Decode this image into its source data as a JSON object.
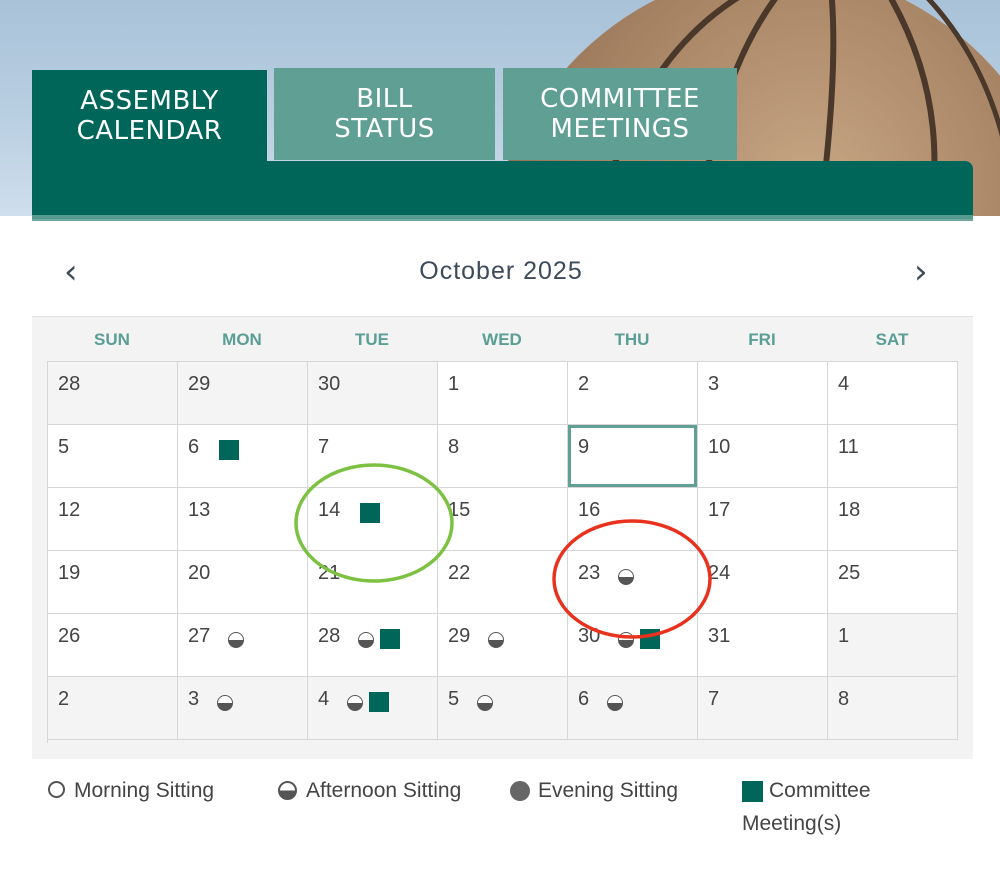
{
  "tabs": [
    {
      "label": "ASSEMBLY\nCALENDAR"
    },
    {
      "label": "BILL\nSTATUS"
    },
    {
      "label": "COMMITTEE\nMEETINGS"
    }
  ],
  "calendar": {
    "month_title": "October 2025",
    "prev_label": "‹",
    "next_label": "›",
    "days_of_week": [
      "SUN",
      "MON",
      "TUE",
      "WED",
      "THU",
      "FRI",
      "SAT"
    ],
    "weeks": [
      [
        {
          "day": "28",
          "other": true
        },
        {
          "day": "29",
          "other": true
        },
        {
          "day": "30",
          "other": true
        },
        {
          "day": "1"
        },
        {
          "day": "2"
        },
        {
          "day": "3"
        },
        {
          "day": "4"
        }
      ],
      [
        {
          "day": "5"
        },
        {
          "day": "6",
          "committee": true
        },
        {
          "day": "7"
        },
        {
          "day": "8"
        },
        {
          "day": "9",
          "today": true
        },
        {
          "day": "10"
        },
        {
          "day": "11"
        }
      ],
      [
        {
          "day": "12"
        },
        {
          "day": "13"
        },
        {
          "day": "14",
          "committee": true
        },
        {
          "day": "15"
        },
        {
          "day": "16"
        },
        {
          "day": "17"
        },
        {
          "day": "18"
        }
      ],
      [
        {
          "day": "19"
        },
        {
          "day": "20"
        },
        {
          "day": "21"
        },
        {
          "day": "22"
        },
        {
          "day": "23",
          "afternoon": true
        },
        {
          "day": "24"
        },
        {
          "day": "25"
        }
      ],
      [
        {
          "day": "26"
        },
        {
          "day": "27",
          "afternoon": true
        },
        {
          "day": "28",
          "afternoon": true,
          "committee": true
        },
        {
          "day": "29",
          "afternoon": true
        },
        {
          "day": "30",
          "afternoon": true,
          "committee": true
        },
        {
          "day": "31"
        },
        {
          "day": "1",
          "other": true
        }
      ],
      [
        {
          "day": "2",
          "other": true
        },
        {
          "day": "3",
          "afternoon": true,
          "other": true
        },
        {
          "day": "4",
          "afternoon": true,
          "committee": true,
          "other": true
        },
        {
          "day": "5",
          "afternoon": true,
          "other": true
        },
        {
          "day": "6",
          "afternoon": true,
          "other": true
        },
        {
          "day": "7",
          "other": true
        },
        {
          "day": "8",
          "other": true
        }
      ]
    ]
  },
  "legend": {
    "morning": "Morning Sitting",
    "afternoon": "Afternoon Sitting",
    "evening": "Evening Sitting",
    "committee_line1": "Committee",
    "committee_line2": "Meeting(s)"
  },
  "colors": {
    "brand_dark": "#00665a",
    "brand_light": "#5f9f94",
    "annotation_green": "#7cc142",
    "annotation_red": "#e8321e"
  },
  "icons": [
    "morning-sitting-icon",
    "afternoon-sitting-icon",
    "evening-sitting-icon",
    "committee-meeting-icon"
  ]
}
